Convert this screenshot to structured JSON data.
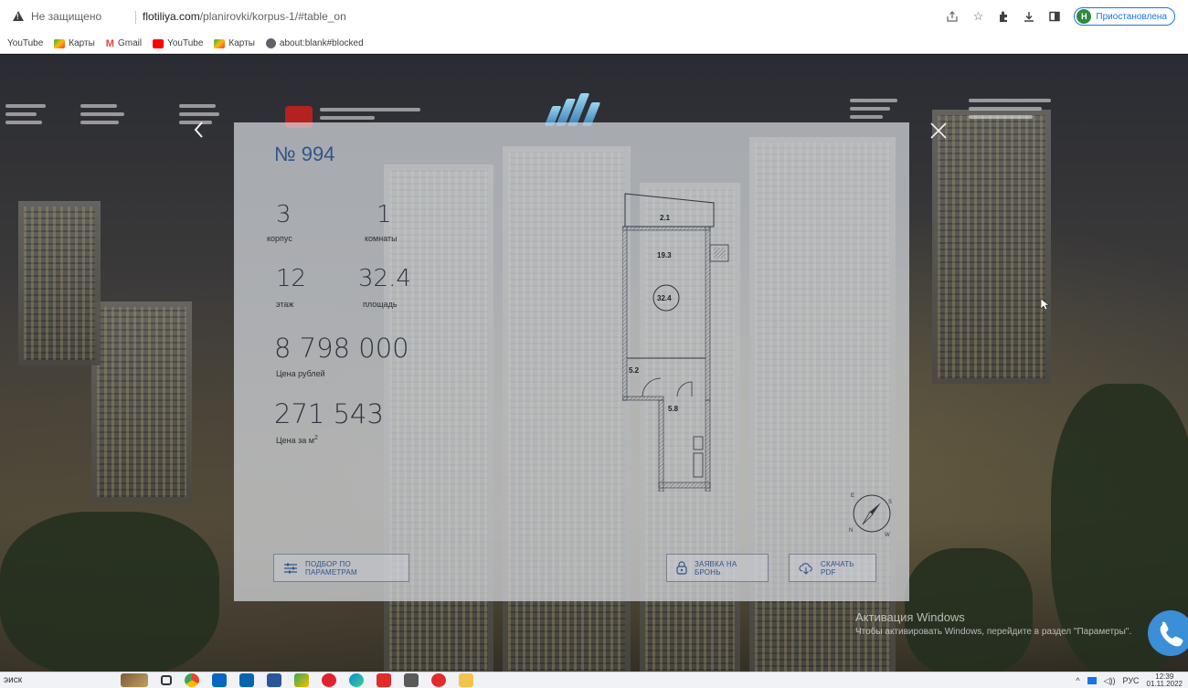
{
  "browser": {
    "security_label": "Не защищено",
    "url_domain": "flotiliya.com",
    "url_path": "/planirovki/korpus-1/#table_on",
    "profile_initial": "Н",
    "profile_label": "Приостановлена"
  },
  "bookmarks": [
    {
      "label": "YouTube",
      "color": "#ffffff"
    },
    {
      "label": "Карты",
      "color": "#34a853"
    },
    {
      "label": "Gmail",
      "color": "#ea4335"
    },
    {
      "label": "YouTube",
      "color": "#ff0000"
    },
    {
      "label": "Карты",
      "color": "#34a853"
    },
    {
      "label": "about:blank#blocked",
      "color": "#5f6368"
    }
  ],
  "modal": {
    "title": "№ 994",
    "korpus_value": "3",
    "korpus_label": "корпус",
    "rooms_value": "1",
    "rooms_label": "комнаты",
    "floor_value": "12",
    "floor_label": "этаж",
    "area_value": "32.4",
    "area_label": "площадь",
    "price_value": "8 798 000",
    "price_label": "Цена рублей",
    "price_m2_value": "271 543",
    "price_m2_label": "Цена за м",
    "price_m2_sup": "2",
    "plan": {
      "balcony": "2.1",
      "main_room": "19.3",
      "total_badge": "32.4",
      "hall": "5.2",
      "bath": "5.8"
    },
    "compass_labels": {
      "e": "E",
      "s": "S",
      "n": "N",
      "w": "W"
    },
    "buttons": {
      "filter": "ПОДБОР ПО ПАРАМЕТРАМ",
      "reserve": "ЗАЯВКА НА БРОНЬ",
      "pdf": "СКАЧАТЬ PDF"
    }
  },
  "windows_activation": {
    "title": "Активация Windows",
    "subtitle": "Чтобы активировать Windows, перейдите в раздел \"Параметры\"."
  },
  "taskbar": {
    "search_label": "эиск",
    "language": "РУС",
    "time": "12:39",
    "date": "01.11.2022"
  },
  "colors": {
    "accent": "#33538a",
    "modal_bg": "#dadee4",
    "call_button": "#3b8fd6"
  }
}
